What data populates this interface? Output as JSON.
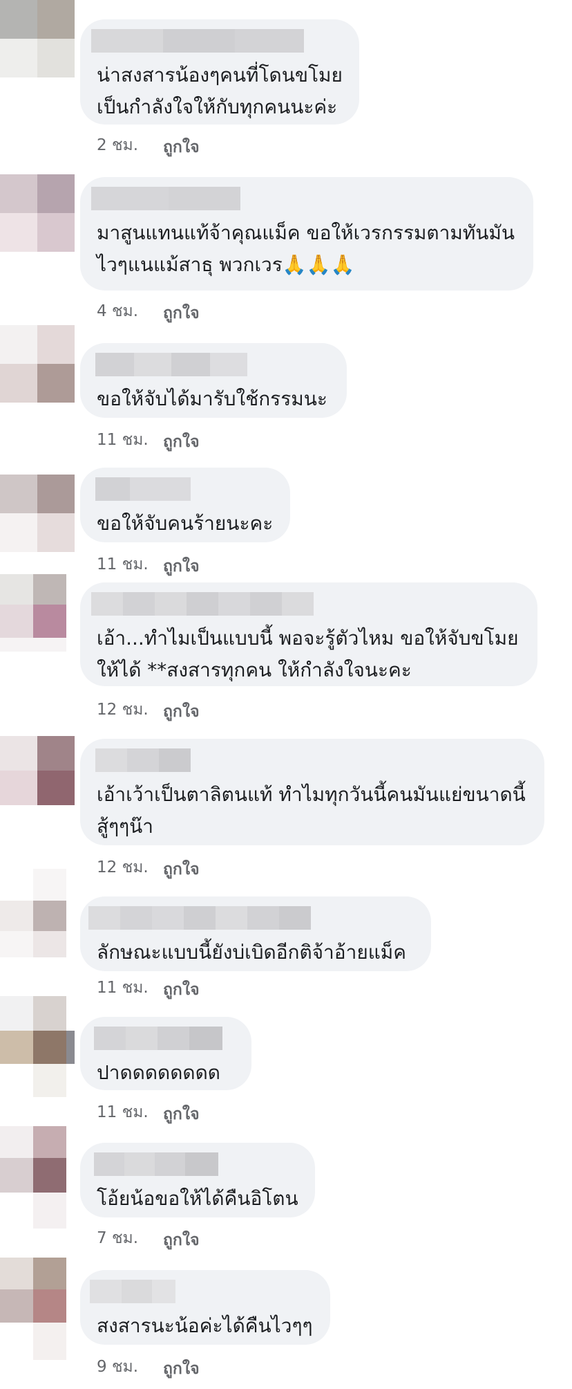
{
  "like_label": "ถูกใจ",
  "comments": [
    {
      "text_lines": [
        "น่าสงสารน้องๆคนที่โดนขโมย",
        "เป็นกำลังใจให้กับทุกคนนะค่ะ"
      ],
      "time": "2 ชม."
    },
    {
      "text_lines": [
        "มาสูนแทนแท้จ้าคุณแม็ค ขอให้เวรกรรมตามทันมัน",
        "ไวๆแนแม้สาธุ พวกเวร🙏🙏🙏"
      ],
      "time": "4 ชม."
    },
    {
      "text_lines": [
        "ขอให้จับได้มารับใช้กรรมนะ"
      ],
      "time": "11 ชม."
    },
    {
      "text_lines": [
        "ขอให้จับคนร้ายนะคะ"
      ],
      "time": "11 ชม."
    },
    {
      "text_lines": [
        "เอ้า...ทำไมเป็นแบบนี้ พอจะรู้ตัวไหม ขอให้จับขโมย",
        "ให้ได้  **สงสารทุกคน ให้กำลังใจนะคะ"
      ],
      "time": "12 ชม."
    },
    {
      "text_lines": [
        "เอ้าเว้าเป็นตาลิตนแท้ ทำไมทุกวันนี้คนมันแย่ขนาดนี้",
        "สู้ๆๆน๊า"
      ],
      "time": "12 ชม."
    },
    {
      "text_lines": [
        "ลักษณะแบบนี้ยังบ่เบิดอีกติจ้าอ้ายแม็ค"
      ],
      "time": "11 ชม."
    },
    {
      "text_lines": [
        "ปาดดดดดดดด"
      ],
      "time": "11 ชม."
    },
    {
      "text_lines": [
        "โอ้ยน้อขอให้ได้คืนอิโตน"
      ],
      "time": "7 ชม."
    },
    {
      "text_lines": [
        "สงสารนะน้อค่ะได้คืนไวๆๆ"
      ],
      "time": "9 ชม."
    }
  ],
  "colors": {
    "bubble": "#f0f2f5",
    "text": "#1c1e21",
    "meta": "#65676b"
  },
  "icons": [
    "folded-hands-emoji"
  ]
}
